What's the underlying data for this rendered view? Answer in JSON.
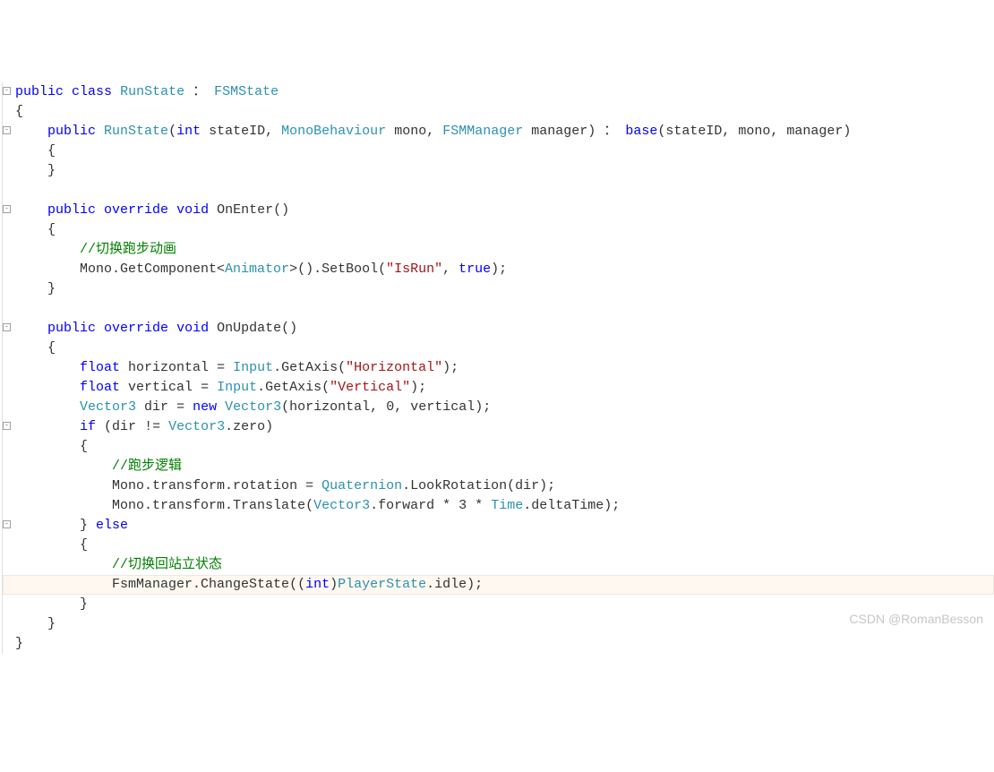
{
  "watermark": "CSDN @RomanBesson",
  "code": [
    {
      "fold": "-",
      "indent": 0,
      "tokens": [
        [
          "kw",
          "public"
        ],
        [
          "",
          ""
        ],
        [
          "kw",
          "class"
        ],
        [
          "",
          ""
        ],
        [
          "type",
          "RunState"
        ],
        [
          "",
          ""
        ],
        [
          "",
          "："
        ],
        [
          "",
          ""
        ],
        [
          "type",
          "FSMState"
        ]
      ]
    },
    {
      "fold": "",
      "indent": 0,
      "tokens": [
        [
          "",
          "{"
        ]
      ]
    },
    {
      "fold": "-",
      "indent": 4,
      "tokens": [
        [
          "kw",
          "public"
        ],
        [
          "",
          ""
        ],
        [
          "type",
          "RunState"
        ],
        [
          "",
          "("
        ],
        [
          "kw",
          "int"
        ],
        [
          "",
          ""
        ],
        [
          "",
          "stateID,"
        ],
        [
          "",
          ""
        ],
        [
          "type",
          "MonoBehaviour"
        ],
        [
          "",
          ""
        ],
        [
          "",
          "mono,"
        ],
        [
          "",
          ""
        ],
        [
          "type",
          "FSMManager"
        ],
        [
          "",
          ""
        ],
        [
          "",
          "manager)"
        ],
        [
          "",
          ""
        ],
        [
          "",
          "："
        ],
        [
          "",
          ""
        ],
        [
          "kw",
          "base"
        ],
        [
          "",
          "(stateID,"
        ],
        [
          "",
          ""
        ],
        [
          "",
          "mono,"
        ],
        [
          "",
          ""
        ],
        [
          "",
          "manager)"
        ]
      ]
    },
    {
      "fold": "",
      "indent": 4,
      "tokens": [
        [
          "",
          "{"
        ]
      ]
    },
    {
      "fold": "",
      "indent": 4,
      "tokens": [
        [
          "",
          "}"
        ]
      ]
    },
    {
      "fold": "",
      "indent": 0,
      "tokens": []
    },
    {
      "fold": "-",
      "indent": 4,
      "tokens": [
        [
          "kw",
          "public"
        ],
        [
          "",
          ""
        ],
        [
          "kw",
          "override"
        ],
        [
          "",
          ""
        ],
        [
          "kw",
          "void"
        ],
        [
          "",
          ""
        ],
        [
          "",
          "OnEnter()"
        ]
      ]
    },
    {
      "fold": "",
      "indent": 4,
      "tokens": [
        [
          "",
          "{"
        ]
      ]
    },
    {
      "fold": "",
      "indent": 8,
      "tokens": [
        [
          "comm",
          "//切换跑步动画"
        ]
      ]
    },
    {
      "fold": "",
      "indent": 8,
      "tokens": [
        [
          "",
          "Mono.GetComponent<"
        ],
        [
          "type",
          "Animator"
        ],
        [
          "",
          ">().SetBool("
        ],
        [
          "str",
          "\"IsRun\""
        ],
        [
          "",
          ","
        ],
        [
          "",
          ""
        ],
        [
          "kw",
          "true"
        ],
        [
          "",
          ");"
        ]
      ]
    },
    {
      "fold": "",
      "indent": 4,
      "tokens": [
        [
          "",
          "}"
        ]
      ]
    },
    {
      "fold": "",
      "indent": 0,
      "tokens": []
    },
    {
      "fold": "-",
      "indent": 4,
      "tokens": [
        [
          "kw",
          "public"
        ],
        [
          "",
          ""
        ],
        [
          "kw",
          "override"
        ],
        [
          "",
          ""
        ],
        [
          "kw",
          "void"
        ],
        [
          "",
          ""
        ],
        [
          "",
          "OnUpdate()"
        ]
      ]
    },
    {
      "fold": "",
      "indent": 4,
      "tokens": [
        [
          "",
          "{"
        ]
      ]
    },
    {
      "fold": "",
      "indent": 8,
      "tokens": [
        [
          "kw",
          "float"
        ],
        [
          "",
          ""
        ],
        [
          "",
          "horizontal"
        ],
        [
          "",
          ""
        ],
        [
          "",
          "="
        ],
        [
          "",
          ""
        ],
        [
          "type",
          "Input"
        ],
        [
          "",
          ".GetAxis("
        ],
        [
          "str",
          "\"Horizontal\""
        ],
        [
          "",
          ");"
        ]
      ]
    },
    {
      "fold": "",
      "indent": 8,
      "tokens": [
        [
          "kw",
          "float"
        ],
        [
          "",
          ""
        ],
        [
          "",
          "vertical"
        ],
        [
          "",
          ""
        ],
        [
          "",
          "="
        ],
        [
          "",
          ""
        ],
        [
          "type",
          "Input"
        ],
        [
          "",
          ".GetAxis("
        ],
        [
          "str",
          "\"Vertical\""
        ],
        [
          "",
          ");"
        ]
      ]
    },
    {
      "fold": "",
      "indent": 8,
      "tokens": [
        [
          "type",
          "Vector3"
        ],
        [
          "",
          ""
        ],
        [
          "",
          "dir"
        ],
        [
          "",
          ""
        ],
        [
          "",
          "="
        ],
        [
          "",
          ""
        ],
        [
          "kw",
          "new"
        ],
        [
          "",
          ""
        ],
        [
          "type",
          "Vector3"
        ],
        [
          "",
          "(horizontal,"
        ],
        [
          "",
          ""
        ],
        [
          "",
          "0,"
        ],
        [
          "",
          ""
        ],
        [
          "",
          "vertical);"
        ]
      ]
    },
    {
      "fold": "-",
      "indent": 8,
      "tokens": [
        [
          "kw",
          "if"
        ],
        [
          "",
          ""
        ],
        [
          "",
          "(dir"
        ],
        [
          "",
          ""
        ],
        [
          "",
          "!="
        ],
        [
          "",
          ""
        ],
        [
          "type",
          "Vector3"
        ],
        [
          "",
          ".zero)"
        ]
      ]
    },
    {
      "fold": "",
      "indent": 8,
      "tokens": [
        [
          "",
          "{"
        ]
      ]
    },
    {
      "fold": "",
      "indent": 12,
      "tokens": [
        [
          "comm",
          "//跑步逻辑"
        ]
      ]
    },
    {
      "fold": "",
      "indent": 12,
      "tokens": [
        [
          "",
          "Mono.transform.rotation"
        ],
        [
          "",
          ""
        ],
        [
          "",
          "="
        ],
        [
          "",
          ""
        ],
        [
          "type",
          "Quaternion"
        ],
        [
          "",
          ".LookRotation(dir);"
        ]
      ]
    },
    {
      "fold": "",
      "indent": 12,
      "tokens": [
        [
          "",
          "Mono.transform.Translate("
        ],
        [
          "type",
          "Vector3"
        ],
        [
          "",
          ".forward"
        ],
        [
          "",
          ""
        ],
        [
          "",
          "*"
        ],
        [
          "",
          ""
        ],
        [
          "",
          "3"
        ],
        [
          "",
          ""
        ],
        [
          "",
          "*"
        ],
        [
          "",
          ""
        ],
        [
          "type",
          "Time"
        ],
        [
          "",
          ".deltaTime);"
        ]
      ]
    },
    {
      "fold": "-",
      "indent": 8,
      "tokens": [
        [
          "",
          "}"
        ],
        [
          "",
          ""
        ],
        [
          "kw",
          "else"
        ]
      ]
    },
    {
      "fold": "",
      "indent": 8,
      "tokens": [
        [
          "",
          "{"
        ]
      ]
    },
    {
      "fold": "",
      "indent": 12,
      "tokens": [
        [
          "comm",
          "//切换回站立状态"
        ]
      ]
    },
    {
      "fold": "",
      "indent": 12,
      "highlight": true,
      "tokens": [
        [
          "",
          "FsmManager.ChangeState(("
        ],
        [
          "kw",
          "int"
        ],
        [
          "",
          ")"
        ],
        [
          "type",
          "PlayerState"
        ],
        [
          "",
          ".idle);"
        ]
      ]
    },
    {
      "fold": "",
      "indent": 8,
      "tokens": [
        [
          "",
          "}"
        ]
      ]
    },
    {
      "fold": "",
      "indent": 4,
      "tokens": [
        [
          "",
          "}"
        ]
      ]
    },
    {
      "fold": "",
      "indent": 0,
      "tokens": [
        [
          "",
          "}"
        ]
      ]
    }
  ]
}
